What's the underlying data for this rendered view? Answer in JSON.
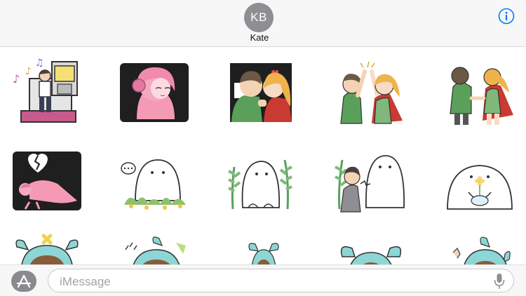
{
  "header": {
    "avatar_initials": "KB",
    "contact_name": "Kate",
    "info_icon": "info-icon",
    "accent": "#007aff"
  },
  "stickers": [
    "dance-machine-boy-sticker",
    "headphones-pink-girl-sticker",
    "couple-kiss-sticker",
    "high-five-couple-sticker",
    "holding-hands-couple-sticker",
    "broken-heart-girl-sticker",
    "ghost-speech-bubble-sticker",
    "ghost-in-plants-sticker",
    "ghost-and-boy-sticker",
    "ghost-with-flower-sticker",
    "horned-girl-sticker",
    "horned-girl-sleepy-sticker",
    "horned-girl-small-sticker",
    "horned-girl-face-sticker",
    "horned-girl-waving-sticker"
  ],
  "footer": {
    "app_store_icon": "app-store-icon",
    "input_placeholder": "iMessage",
    "mic_icon": "microphone-icon"
  }
}
